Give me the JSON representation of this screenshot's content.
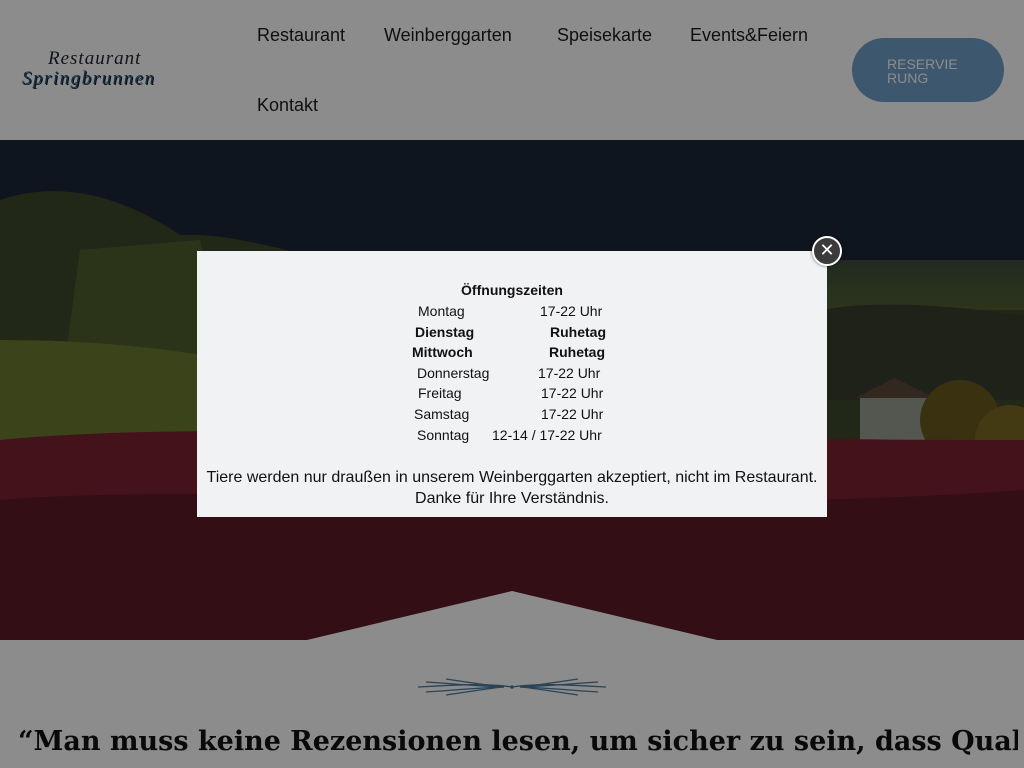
{
  "header": {
    "logo": {
      "line1": "Restaurant",
      "line2": "Springbrunnen"
    },
    "nav": [
      {
        "label": "Restaurant"
      },
      {
        "label": "Weinberggarten"
      },
      {
        "label": "Speisekarte"
      },
      {
        "label": "Events&Feiern"
      },
      {
        "label": "Kontakt"
      }
    ],
    "reserve_button": "RESERVIERUNG"
  },
  "quote": "“Man muss keine Rezensionen lesen, um sicher zu sein, dass Qualität auf",
  "modal": {
    "title": "Öffnungszeiten",
    "hours": [
      {
        "day": "Montag",
        "time": "17-22 Uhr",
        "closed": false
      },
      {
        "day": "Dienstag",
        "time": "Ruhetag",
        "closed": true
      },
      {
        "day": "Mittwoch",
        "time": "Ruhetag",
        "closed": true
      },
      {
        "day": "Donnerstag",
        "time": "17-22 Uhr",
        "closed": false
      },
      {
        "day": "Freitag",
        "time": "17-22 Uhr",
        "closed": false
      },
      {
        "day": "Samstag",
        "time": "17-22 Uhr",
        "closed": false
      },
      {
        "day": "Sonntag",
        "time": "12-14 / 17-22 Uhr",
        "closed": false
      }
    ],
    "note_line1": "Tiere werden nur draußen in unserem Weinberggarten akzeptiert, nicht im Restaurant.",
    "note_line2": "Danke für Ihre Verständnis.",
    "close_icon": "close-icon"
  },
  "colors": {
    "accent": "#6f9fcb",
    "logo_blue": "#2f5578",
    "modal_bg": "#f1f2f4",
    "overlay": "rgba(0,0,0,0.45)"
  }
}
